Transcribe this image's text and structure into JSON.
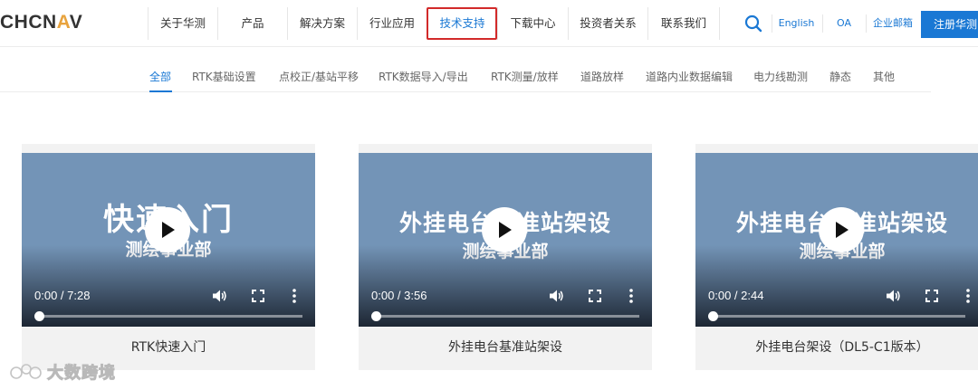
{
  "header": {
    "logo": {
      "prefix": "CHCN",
      "accent": "A",
      "suffix": "V"
    },
    "nav": [
      {
        "label": "关于华测",
        "width": 77
      },
      {
        "label": "产品",
        "width": 77
      },
      {
        "label": "解决方案",
        "width": 77
      },
      {
        "label": "行业应用",
        "width": 77
      },
      {
        "label": "技术支持",
        "width": 78,
        "active": true
      },
      {
        "label": "下载中心",
        "width": 78
      },
      {
        "label": "投资者关系",
        "width": 88
      },
      {
        "label": "联系我们",
        "width": 80
      }
    ],
    "utils": {
      "english": "English",
      "oa": "OA",
      "mail": "企业邮箱"
    },
    "register_label": "注册华测"
  },
  "categories": [
    {
      "label": "全部",
      "active": true
    },
    {
      "label": "RTK基础设置"
    },
    {
      "label": "点校正/基站平移"
    },
    {
      "label": "RTK数据导入/导出"
    },
    {
      "label": "RTK测量/放样"
    },
    {
      "label": "道路放样"
    },
    {
      "label": "道路内业数据编辑"
    },
    {
      "label": "电力线勘测"
    },
    {
      "label": "静态"
    },
    {
      "label": "其他"
    }
  ],
  "videos": [
    {
      "title": "快速入门",
      "subtitle": "测绘事业部",
      "time": "0:00 / 7:28",
      "caption": "RTK快速入门",
      "progress": 0
    },
    {
      "title": "外挂电台基准站架设",
      "subtitle": "测绘事业部",
      "time": "0:00 / 3:56",
      "caption": "外挂电台基准站架设",
      "progress": 0
    },
    {
      "title": "外挂电台基准站架设",
      "subtitle": "测绘事业部",
      "time": "0:00 / 2:44",
      "caption": "外挂电台架设（DL5-C1版本）",
      "progress": 0
    }
  ],
  "watermark": "大数跨境",
  "colors": {
    "accent": "#1a78d4",
    "highlight": "#d22a2a",
    "logo_accent": "#e8a33d",
    "video_bg": "#7394b7"
  }
}
